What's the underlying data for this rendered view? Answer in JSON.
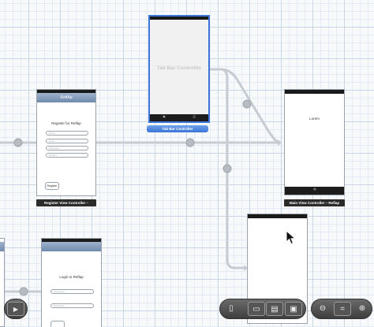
{
  "scenes": {
    "tab_bar_controller": {
      "placeholder_title": "Tab Bar Controller",
      "label": "Tab Bar Controller",
      "tab_icons": [
        "star-icon",
        "list-icon"
      ]
    },
    "register": {
      "nav_title": "ReflAp",
      "heading": "Register for Reflap",
      "fields": [
        "Name",
        "Email",
        "Password",
        "Confirm"
      ],
      "button": "Register",
      "label": "Register View Controller –"
    },
    "main": {
      "text": "Lorem",
      "label": "Main View Controller – Reflap"
    },
    "login": {
      "heading": "Login to Reflap",
      "fields": [
        "Username",
        "Password"
      ]
    }
  },
  "colors": {
    "selection": "#3b74d6",
    "segue_line": "#c2c7cc",
    "scene_label": "#2b2b2b"
  },
  "toolbar": {
    "left_icon": "play-icon",
    "scene_icons": [
      "iphone-icon",
      "layout-icon",
      "layout-split-icon",
      "layout-full-icon"
    ],
    "zoom_icons": [
      "zoom-out-icon",
      "zoom-reset-icon",
      "zoom-in-icon"
    ]
  }
}
